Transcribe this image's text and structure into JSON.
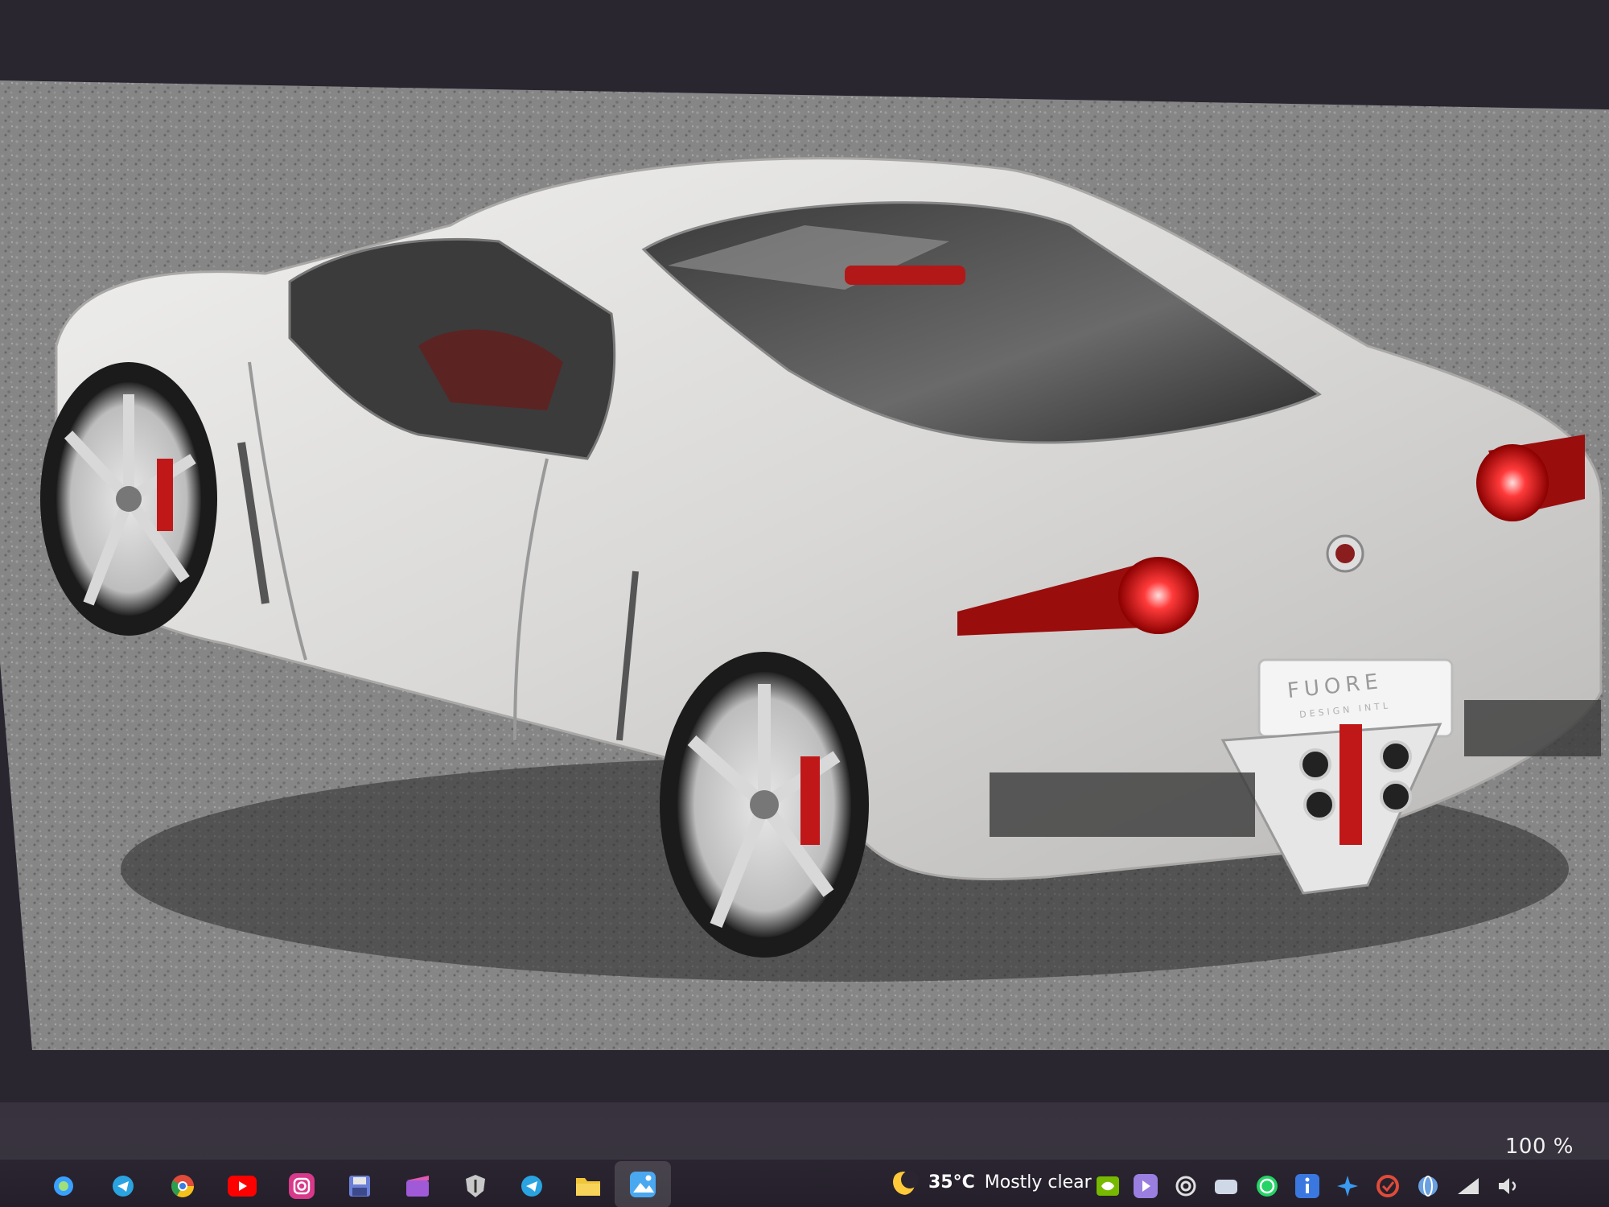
{
  "viewer": {
    "zoom_level": "100 %"
  },
  "photo": {
    "subject": "silver sports coupe",
    "badge_text_line1": "FUORE",
    "badge_text_line2": "DESIGN INTL"
  },
  "taskbar": {
    "apps": [
      {
        "name": "copilot-icon",
        "color": "#3aa0ff"
      },
      {
        "name": "telegram-icon",
        "color": "#2aa3e0"
      },
      {
        "name": "chrome-icon",
        "color": "#e04b3a"
      },
      {
        "name": "youtube-icon",
        "color": "#ff0000"
      },
      {
        "name": "instagram-icon",
        "color": "#d8398a"
      },
      {
        "name": "save-disk-icon",
        "color": "#6b7fd6"
      },
      {
        "name": "clapper-icon",
        "color": "#a05ad8"
      },
      {
        "name": "game-shield-icon",
        "color": "#c8c8c8"
      },
      {
        "name": "telegram-desktop-icon",
        "color": "#2aa3e0"
      },
      {
        "name": "file-explorer-icon",
        "color": "#f0c53a"
      },
      {
        "name": "photos-icon",
        "color": "#4aa8f0"
      }
    ],
    "weather": {
      "temperature": "35°C",
      "description": "Mostly clear"
    },
    "tray": [
      {
        "name": "nvidia-icon",
        "color": "#76b900"
      },
      {
        "name": "media-icon",
        "color": "#9a7fe0"
      },
      {
        "name": "sync-icon",
        "color": "#e0e0e0"
      },
      {
        "name": "cloud-icon",
        "color": "#cfd8e6"
      },
      {
        "name": "whatsapp-icon",
        "color": "#25d366"
      },
      {
        "name": "info-icon",
        "color": "#3a78e0"
      },
      {
        "name": "sparkle-icon",
        "color": "#3a9af0"
      },
      {
        "name": "antivirus-icon",
        "color": "#e04b3a"
      },
      {
        "name": "globe-icon",
        "color": "#6aa0e0"
      },
      {
        "name": "network-icon",
        "color": "#e0e0e0"
      }
    ]
  }
}
